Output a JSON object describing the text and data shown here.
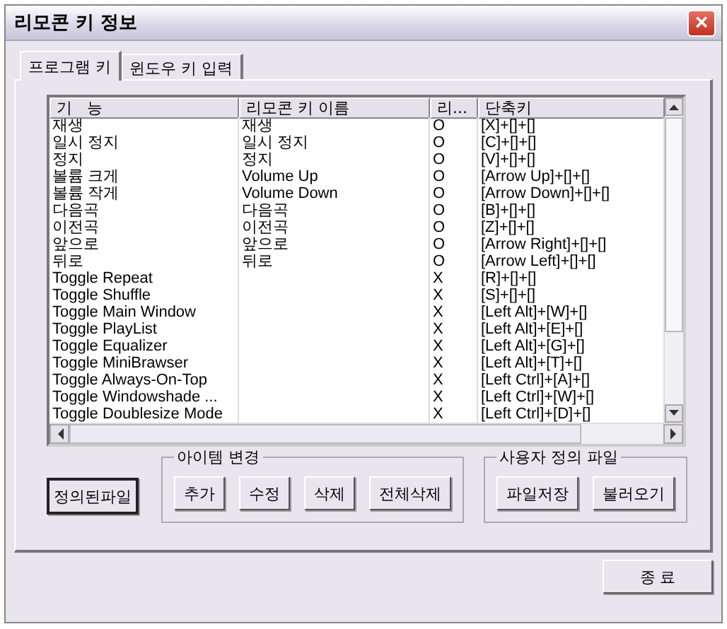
{
  "window": {
    "title": "리모콘 키 정보",
    "close": "×"
  },
  "tabs": [
    {
      "label": "프로그램 키",
      "selected": true
    },
    {
      "label": "윈도우 키 입력",
      "selected": false
    }
  ],
  "table": {
    "columns": [
      "기   능",
      "리모콘 키 이름",
      "리...",
      "단축키"
    ],
    "rows": [
      [
        "재생",
        "재생",
        "O",
        "[X]+[]+[]"
      ],
      [
        "일시 정지",
        "일시 정지",
        "O",
        "[C]+[]+[]"
      ],
      [
        "정지",
        "정지",
        "O",
        "[V]+[]+[]"
      ],
      [
        "볼륨 크게",
        "Volume Up",
        "O",
        "[Arrow Up]+[]+[]"
      ],
      [
        "볼륨 작게",
        "Volume Down",
        "O",
        "[Arrow Down]+[]+[]"
      ],
      [
        "다음곡",
        "다음곡",
        "O",
        "[B]+[]+[]"
      ],
      [
        "이전곡",
        "이전곡",
        "O",
        "[Z]+[]+[]"
      ],
      [
        "앞으로",
        "앞으로",
        "O",
        "[Arrow Right]+[]+[]"
      ],
      [
        "뒤로",
        "뒤로",
        "O",
        "[Arrow Left]+[]+[]"
      ],
      [
        "Toggle Repeat",
        "",
        "X",
        "[R]+[]+[]"
      ],
      [
        "Toggle Shuffle",
        "",
        "X",
        "[S]+[]+[]"
      ],
      [
        "Toggle Main Window",
        "",
        "X",
        "[Left Alt]+[W]+[]"
      ],
      [
        "Toggle PlayList",
        "",
        "X",
        "[Left Alt]+[E]+[]"
      ],
      [
        "Toggle Equalizer",
        "",
        "X",
        "[Left Alt]+[G]+[]"
      ],
      [
        "Toggle MiniBrawser",
        "",
        "X",
        "[Left Alt]+[T]+[]"
      ],
      [
        "Toggle Always-On-Top",
        "",
        "X",
        "[Left Ctrl]+[A]+[]"
      ],
      [
        "Toggle Windowshade ...",
        "",
        "X",
        "[Left Ctrl]+[W]+[]"
      ],
      [
        "Toggle Doublesize Mode",
        "",
        "X",
        "[Left Ctrl]+[D]+[]"
      ]
    ]
  },
  "default_file_button": "정의된파일",
  "groups": [
    {
      "title": "아이템 변경",
      "buttons": [
        "추가",
        "수정",
        "삭제",
        "전체삭제"
      ]
    },
    {
      "title": "사용자 정의 파일",
      "buttons": [
        "파일저장",
        "불러오기"
      ]
    }
  ],
  "exit_button": "종 료"
}
